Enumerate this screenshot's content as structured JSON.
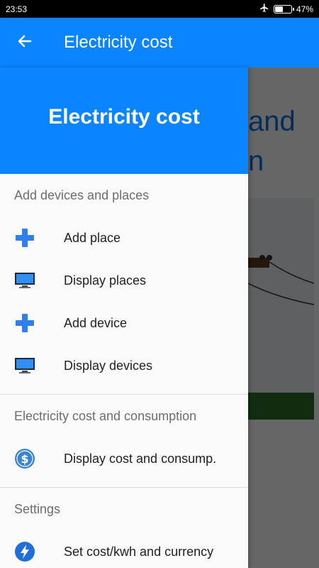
{
  "status_bar": {
    "time": "23:53",
    "battery_percent": "47%",
    "battery_level": 0.47
  },
  "app_bar": {
    "title": "Electricity cost"
  },
  "drawer": {
    "header_title": "Electricity cost",
    "sections": [
      {
        "title": "Add devices and places",
        "items": [
          {
            "label": "Add place",
            "icon": "plus-icon"
          },
          {
            "label": "Display places",
            "icon": "monitor-icon"
          },
          {
            "label": "Add device",
            "icon": "plus-icon"
          },
          {
            "label": "Display devices",
            "icon": "monitor-icon"
          }
        ]
      },
      {
        "title": "Electricity cost and consumption",
        "items": [
          {
            "label": "Display cost and consump.",
            "icon": "dollar-circle-icon"
          }
        ]
      },
      {
        "title": "Settings",
        "items": [
          {
            "label": "Set cost/kwh and currency",
            "icon": "lightning-circle-icon"
          }
        ]
      }
    ]
  },
  "background": {
    "heading_line1": "and",
    "heading_line2": "n"
  },
  "colors": {
    "primary": "#0a84ff",
    "heading_blue": "#0a6fe8",
    "grass": "#2f6e2c"
  }
}
